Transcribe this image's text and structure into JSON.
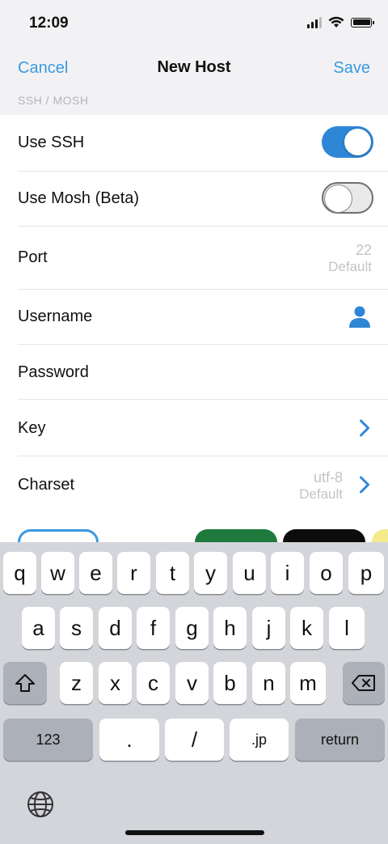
{
  "status": {
    "time": "12:09"
  },
  "nav": {
    "cancel": "Cancel",
    "title": "New Host",
    "save": "Save"
  },
  "section": {
    "header": "SSH / MOSH"
  },
  "rows": {
    "use_ssh": {
      "label": "Use SSH",
      "on": true
    },
    "use_mosh": {
      "label": "Use Mosh (Beta)",
      "on": false
    },
    "port": {
      "label": "Port",
      "value": "22",
      "sub": "Default"
    },
    "username": {
      "label": "Username",
      "icon": "person-icon"
    },
    "password": {
      "label": "Password"
    },
    "key": {
      "label": "Key"
    },
    "charset": {
      "label": "Charset",
      "value": "utf-8",
      "sub": "Default"
    }
  },
  "colors": {
    "accent": "#3a9ae0",
    "toggle_on": "#2e86d6"
  },
  "keyboard": {
    "row1": [
      "q",
      "w",
      "e",
      "r",
      "t",
      "y",
      "u",
      "i",
      "o",
      "p"
    ],
    "row2": [
      "a",
      "s",
      "d",
      "f",
      "g",
      "h",
      "j",
      "k",
      "l"
    ],
    "row3": [
      "z",
      "x",
      "c",
      "v",
      "b",
      "n",
      "m"
    ],
    "bottom": {
      "numbers": "123",
      "dot": ".",
      "slash": "/",
      "jp": ".jp",
      "return": "return"
    }
  }
}
